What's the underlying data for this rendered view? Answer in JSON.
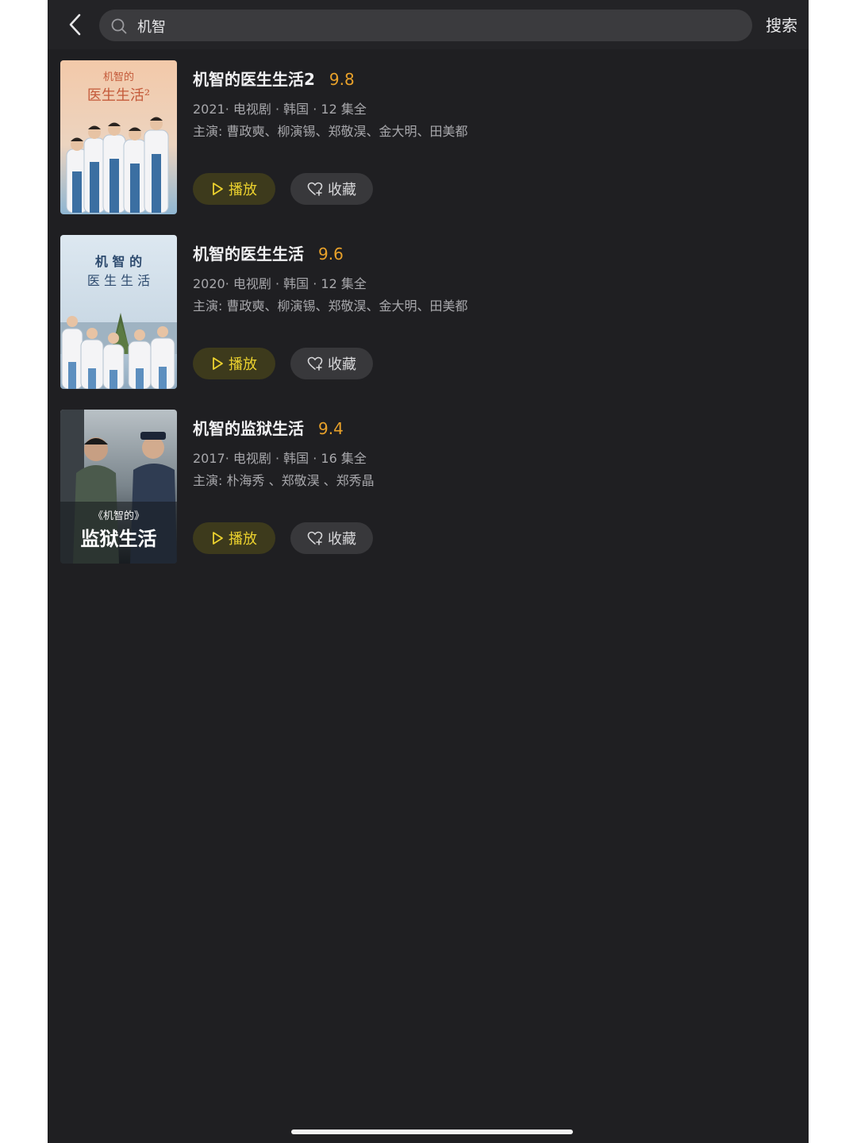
{
  "search": {
    "query": "机智",
    "button_label": "搜索"
  },
  "results": [
    {
      "title": "机智的医生生活2",
      "score": "9.8",
      "meta": "2021· 电视剧 · 韩国 · 12 集全",
      "cast": "主演: 曹政奭、柳演锡、郑敬淏、金大明、田美都",
      "poster_text": [
        "机智的",
        "医生生活²"
      ],
      "play_label": "播放",
      "fav_label": "收藏"
    },
    {
      "title": "机智的医生生活",
      "score": "9.6",
      "meta": "2020· 电视剧 · 韩国 · 12 集全",
      "cast": "主演: 曹政奭、柳演锡、郑敬淏、金大明、田美都",
      "poster_text": [
        "机 智 的",
        "医 生 生 活"
      ],
      "play_label": "播放",
      "fav_label": "收藏"
    },
    {
      "title": "机智的监狱生活",
      "score": "9.4",
      "meta": "2017· 电视剧 · 韩国 · 16 集全",
      "cast": "主演: 朴海秀 、郑敬淏 、郑秀晶",
      "poster_text": [
        "《机智的》",
        "监狱生活"
      ],
      "play_label": "播放",
      "fav_label": "收藏"
    }
  ],
  "colors": {
    "background": "#1f1f22",
    "score": "#e8a12a",
    "play_accent": "#ecd22e",
    "play_bg": "#3d3a1c",
    "fav_bg": "#38383b"
  }
}
